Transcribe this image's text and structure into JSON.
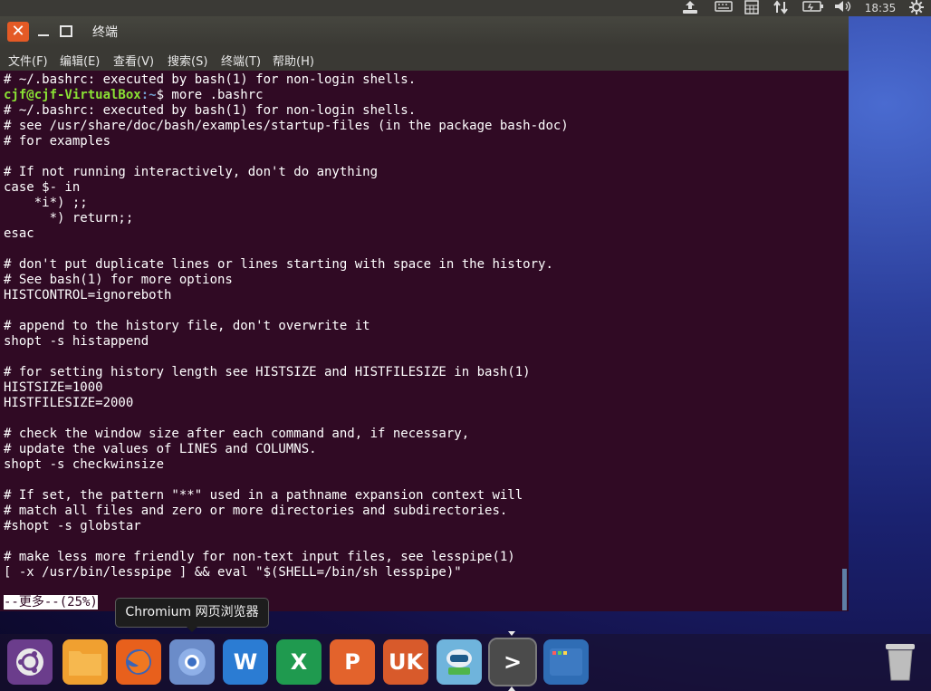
{
  "topbar": {
    "time": "18:35",
    "icons": [
      "upload-icon",
      "keyboard-icon",
      "calculator-icon",
      "network-icon",
      "battery-icon",
      "volume-icon",
      "settings-gear-icon"
    ]
  },
  "window": {
    "title": "终端",
    "menu": [
      "文件(F)",
      "编辑(E)",
      "查看(V)",
      "搜索(S)",
      "终端(T)",
      "帮助(H)"
    ]
  },
  "terminal": {
    "line_first": "# ~/.bashrc: executed by bash(1) for non-login shells.",
    "prompt_user": "cjf@cjf-VirtualBox",
    "prompt_path": ":~",
    "prompt_rest": "$ more .bashrc",
    "lines": [
      "# ~/.bashrc: executed by bash(1) for non-login shells.",
      "# see /usr/share/doc/bash/examples/startup-files (in the package bash-doc)",
      "# for examples",
      "",
      "# If not running interactively, don't do anything",
      "case $- in",
      "    *i*) ;;",
      "      *) return;;",
      "esac",
      "",
      "# don't put duplicate lines or lines starting with space in the history.",
      "# See bash(1) for more options",
      "HISTCONTROL=ignoreboth",
      "",
      "# append to the history file, don't overwrite it",
      "shopt -s histappend",
      "",
      "# for setting history length see HISTSIZE and HISTFILESIZE in bash(1)",
      "HISTSIZE=1000",
      "HISTFILESIZE=2000",
      "",
      "# check the window size after each command and, if necessary,",
      "# update the values of LINES and COLUMNS.",
      "shopt -s checkwinsize",
      "",
      "# If set, the pattern \"**\" used in a pathname expansion context will",
      "# match all files and zero or more directories and subdirectories.",
      "#shopt -s globstar",
      "",
      "# make less more friendly for non-text input files, see lesspipe(1)",
      "[ -x /usr/bin/lesspipe ] && eval \"$(SHELL=/bin/sh lesspipe)\""
    ],
    "more_status": "--更多--(25%)"
  },
  "tooltip": "Chromium 网页浏览器",
  "dock": [
    {
      "name": "ubuntu-logo-icon",
      "label": "",
      "color": "#6b3d8c"
    },
    {
      "name": "files-folder-icon",
      "label": "",
      "color": "#f0a030"
    },
    {
      "name": "firefox-icon",
      "label": "",
      "color": "#e8601c"
    },
    {
      "name": "chromium-icon",
      "label": "",
      "color": "#6b8cc9"
    },
    {
      "name": "word-icon",
      "label": "W",
      "color": "#2b7cd3"
    },
    {
      "name": "excel-icon",
      "label": "X",
      "color": "#1f9a4f"
    },
    {
      "name": "powerpoint-icon",
      "label": "P",
      "color": "#e3632c"
    },
    {
      "name": "ubuntu-software-icon",
      "label": "UK",
      "color": "#d85a2b"
    },
    {
      "name": "robot-app-icon",
      "label": "",
      "color": "#6fb4dc"
    },
    {
      "name": "terminal-icon",
      "label": ">",
      "color": "#4b4b4b"
    },
    {
      "name": "workspace-switcher-icon",
      "label": "",
      "color": "#2f6db5"
    },
    {
      "name": "trash-icon",
      "label": "",
      "color": "#b9b9b9"
    }
  ]
}
